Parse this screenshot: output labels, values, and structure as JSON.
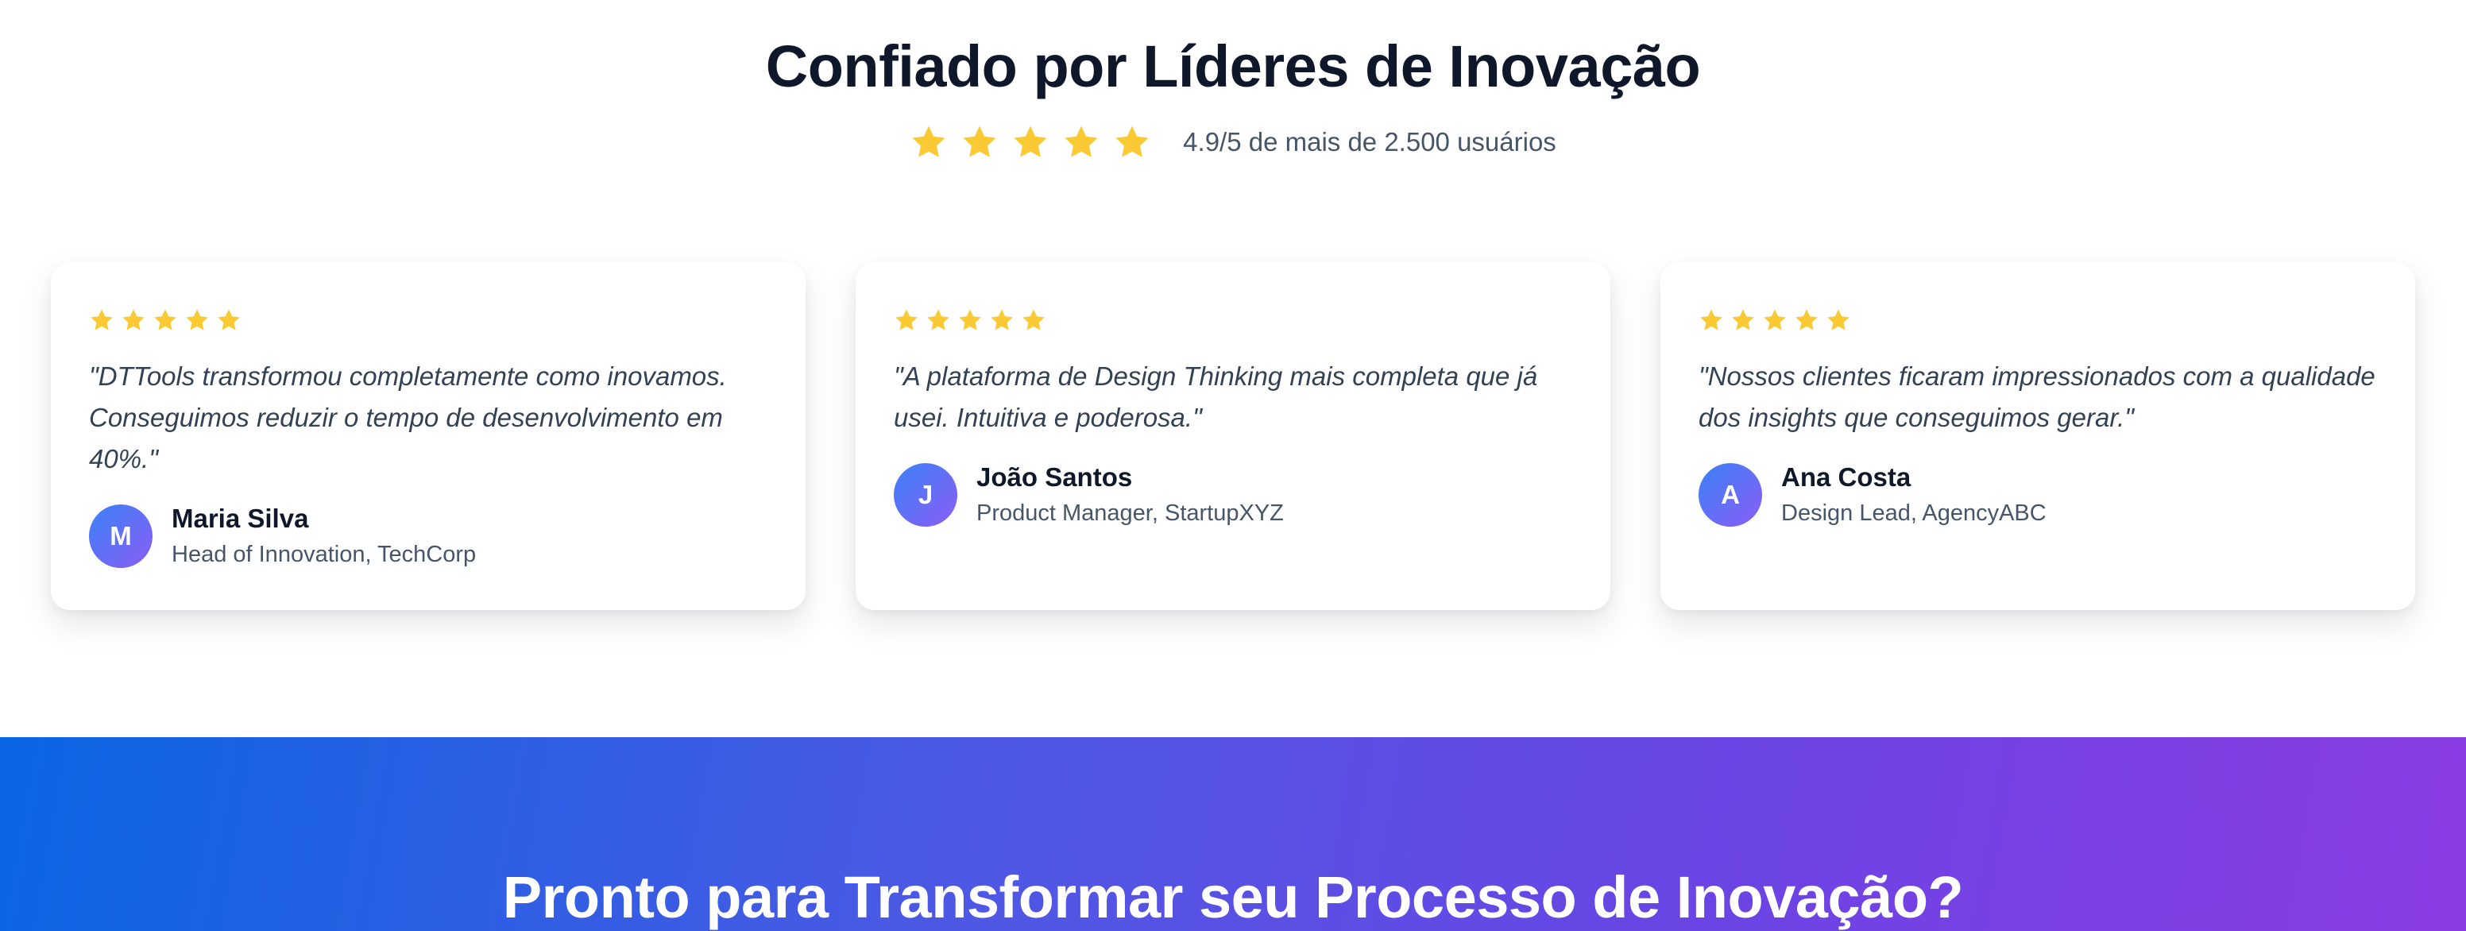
{
  "testimonials": {
    "title": "Confiado por Líderes de Inovação",
    "rating_text": "4.9/5 de mais de 2.500 usuários",
    "star_color": "#fbc934",
    "overall_stars": 5,
    "cards": [
      {
        "stars": 5,
        "quote": "\"DTTools transformou completamente como inovamos. Conseguimos reduzir o tempo de desenvolvimento em 40%.\"",
        "avatar_initial": "M",
        "name": "Maria Silva",
        "role": "Head of Innovation, TechCorp"
      },
      {
        "stars": 5,
        "quote": "\"A plataforma de Design Thinking mais completa que já usei. Intuitiva e poderosa.\"",
        "avatar_initial": "J",
        "name": "João Santos",
        "role": "Product Manager, StartupXYZ"
      },
      {
        "stars": 5,
        "quote": "\"Nossos clientes ficaram impressionados com a qualidade dos insights que conseguimos gerar.\"",
        "avatar_initial": "A",
        "name": "Ana Costa",
        "role": "Design Lead, AgencyABC"
      }
    ]
  },
  "cta": {
    "title": "Pronto para Transformar seu Processo de Inovação?",
    "gradient_start": "#0a66e3",
    "gradient_end": "#8b3ce3"
  }
}
